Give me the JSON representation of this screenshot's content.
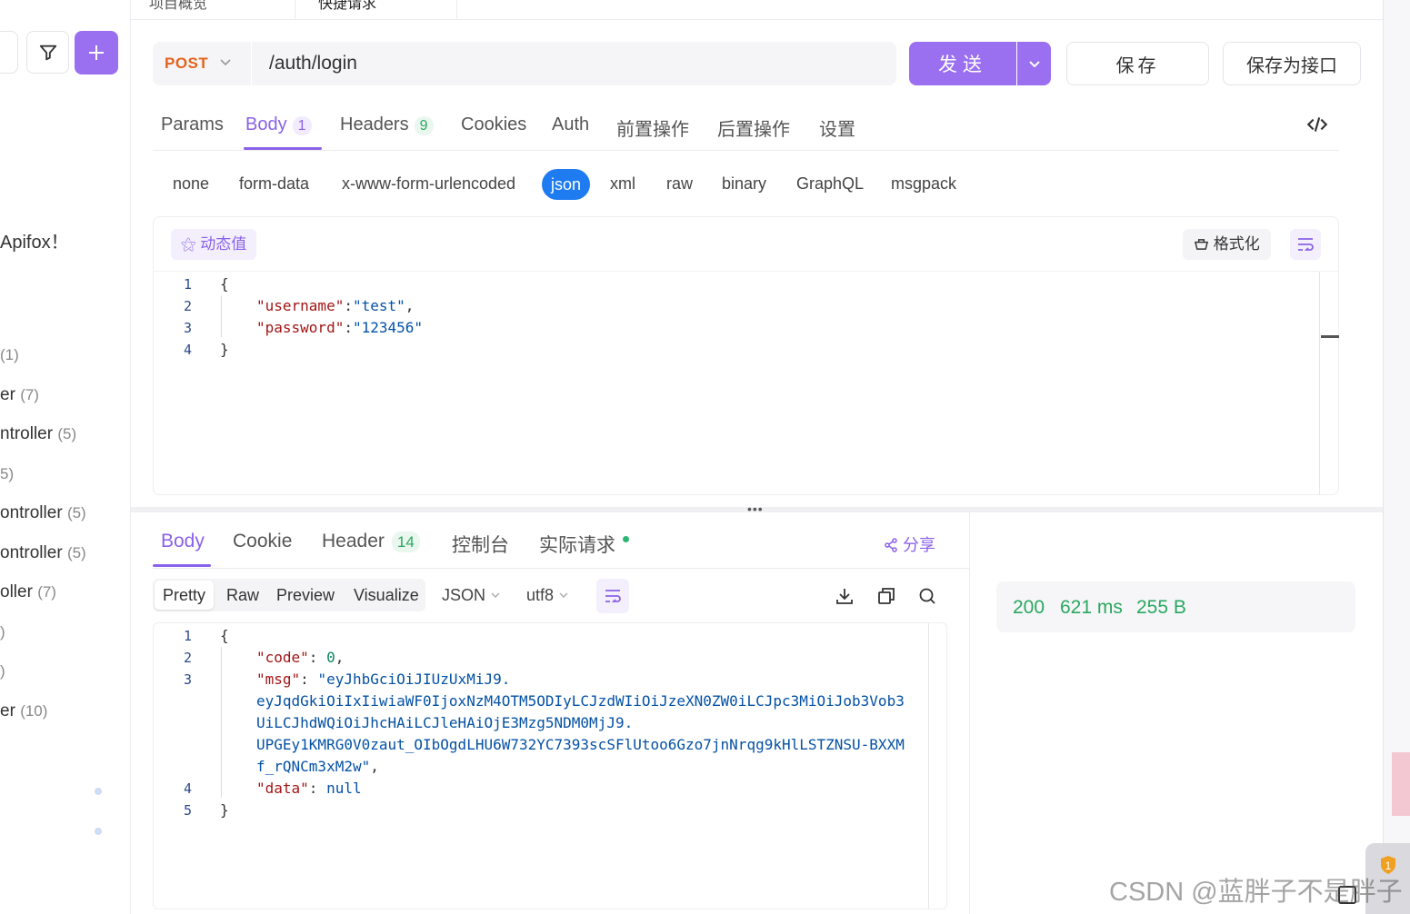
{
  "sidebar": {
    "welcome": "Apifox！",
    "items": [
      {
        "label": "",
        "count": "(1)"
      },
      {
        "label": "er",
        "count": "(7)"
      },
      {
        "label": "ntroller",
        "count": "(5)"
      },
      {
        "label": "",
        "count": "5)"
      },
      {
        "label": "ontroller",
        "count": "(5)"
      },
      {
        "label": "ontroller",
        "count": "(5)"
      },
      {
        "label": "oller",
        "count": "(7)"
      },
      {
        "label": "",
        "count": ")"
      },
      {
        "label": "",
        "count": ")"
      },
      {
        "label": "er",
        "count": "(10)"
      }
    ]
  },
  "tabs": [
    {
      "label": "项目概览"
    },
    {
      "label": "快捷请求"
    }
  ],
  "request": {
    "method": "POST",
    "url": "/auth/login",
    "send_label": "发送",
    "save_label": "保存",
    "save_as_label": "保存为接口"
  },
  "request_tabs": [
    {
      "label": "Params",
      "badge": ""
    },
    {
      "label": "Body",
      "badge": "1"
    },
    {
      "label": "Headers",
      "badge": "9"
    },
    {
      "label": "Cookies",
      "badge": ""
    },
    {
      "label": "Auth",
      "badge": ""
    },
    {
      "label": "前置操作",
      "badge": ""
    },
    {
      "label": "后置操作",
      "badge": ""
    },
    {
      "label": "设置",
      "badge": ""
    }
  ],
  "body_types": [
    "none",
    "form-data",
    "x-www-form-urlencoded",
    "json",
    "xml",
    "raw",
    "binary",
    "GraphQL",
    "msgpack"
  ],
  "body_type_selected": "json",
  "editor": {
    "dynamic_label": "动态值",
    "format_label": "格式化",
    "line_numbers": [
      "1",
      "2",
      "3",
      "4"
    ],
    "username_key": "\"username\"",
    "username_val": "\"test\"",
    "password_key": "\"password\"",
    "password_val": "\"123456\""
  },
  "response_tabs": [
    {
      "label": "Body",
      "badge": ""
    },
    {
      "label": "Cookie",
      "badge": ""
    },
    {
      "label": "Header",
      "badge": "14"
    },
    {
      "label": "控制台",
      "badge": ""
    },
    {
      "label": "实际请求",
      "badge": ""
    }
  ],
  "share_label": "分享",
  "view_options": [
    "Pretty",
    "Raw",
    "Preview",
    "Visualize"
  ],
  "view_selected": "Pretty",
  "format_select": "JSON",
  "encoding_select": "utf8",
  "response": {
    "line_numbers": [
      "1",
      "2",
      "3",
      "4",
      "5"
    ],
    "code_key": "\"code\"",
    "code_val": "0",
    "msg_key": "\"msg\"",
    "msg_line1": "\"eyJhbGciOiJIUzUxMiJ9.",
    "msg_line2": "eyJqdGkiOiIxIiwiaWF0IjoxNzM4OTM5ODIyLCJzdWIiOiJzeXN0ZW0iLCJpc3MiOiJob3Vob3",
    "msg_line3": "UiLCJhdWQiOiJhcHAiLCJleHAiOjE3Mzg5NDM0MjJ9.",
    "msg_line4": "UPGEy1KMRG0V0zaut_OIbOgdLHU6W732YC7393scSFlUtoo6Gzo7jnNrqg9kHlLSTZNSU-BXXM",
    "msg_line5": "f_rQNCm3xM2w\"",
    "data_key": "\"data\"",
    "data_val": "null"
  },
  "status": {
    "code": "200",
    "time": "621 ms",
    "size": "255 B"
  },
  "watermark": "CSDN @蓝胖子不是胖子",
  "colors": {
    "accent": "#9a6ff0",
    "method": "#e5621c",
    "json_active": "#1f7cf0",
    "success": "#2aa760"
  }
}
